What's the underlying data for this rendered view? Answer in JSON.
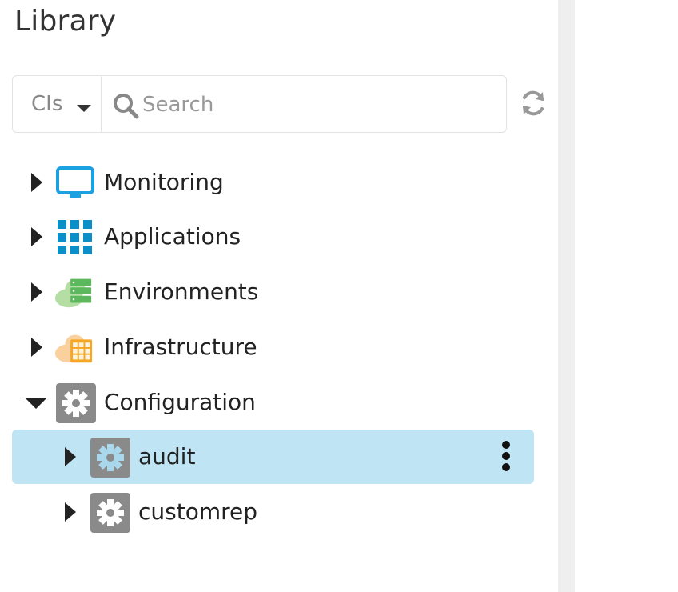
{
  "library": {
    "title": "Library",
    "search": {
      "type_selected": "CIs",
      "placeholder": "Search",
      "value": ""
    },
    "icons": {
      "search": "search-icon",
      "refresh": "refresh-icon",
      "dropdown": "caret-down-icon"
    },
    "tree": [
      {
        "label": "Monitoring",
        "icon": "monitor-icon",
        "expanded": false,
        "level": 0
      },
      {
        "label": "Applications",
        "icon": "grid-icon",
        "expanded": false,
        "level": 0
      },
      {
        "label": "Environments",
        "icon": "cloud-server-icon",
        "expanded": false,
        "level": 0
      },
      {
        "label": "Infrastructure",
        "icon": "cloud-building-icon",
        "expanded": false,
        "level": 0
      },
      {
        "label": "Configuration",
        "icon": "gear-icon",
        "expanded": true,
        "level": 0,
        "children": [
          {
            "label": "audit",
            "icon": "gear-icon",
            "expanded": false,
            "selected": true,
            "level": 1
          },
          {
            "label": "customrep",
            "icon": "gear-icon",
            "expanded": false,
            "level": 1
          }
        ]
      }
    ]
  },
  "colors": {
    "selected_row": "#bfe4f3",
    "monitor_blue": "#1ba1e2",
    "apps_blue": "#0a8fc8",
    "env_green": "#5cb85c",
    "infra_orange": "#f5a623",
    "config_gray": "#8a8a8a",
    "divider": "#efefef"
  }
}
